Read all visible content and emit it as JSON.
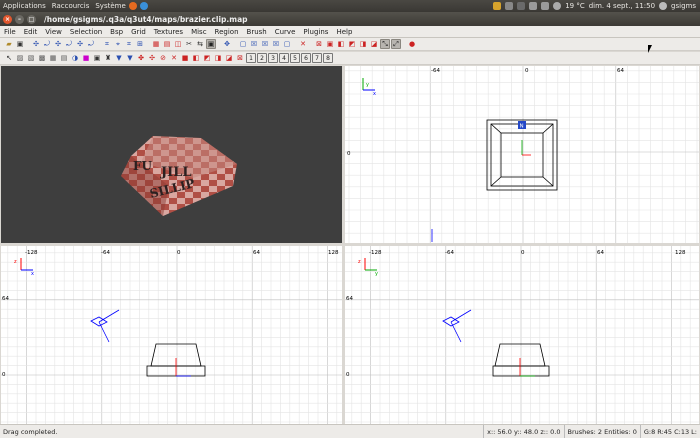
{
  "system_bar": {
    "menus": [
      "Applications",
      "Raccourcis",
      "Système"
    ],
    "weather": "19 °C",
    "clock": "dim.  4 sept., 11:50",
    "user": "gsigms"
  },
  "window": {
    "title": "/home/gsigms/.q3a/q3ut4/maps/brazier.clip.map"
  },
  "menubar": {
    "items": [
      "File",
      "Edit",
      "View",
      "Selection",
      "Bsp",
      "Grid",
      "Textures",
      "Misc",
      "Region",
      "Brush",
      "Curve",
      "Plugins",
      "Help"
    ]
  },
  "toolbar2_numbers": [
    "1",
    "2",
    "3",
    "4",
    "5",
    "6",
    "7",
    "8"
  ],
  "viewports": {
    "top": {
      "ruler_x": [
        "-64",
        "0",
        "64"
      ],
      "ruler_y": [
        "0"
      ],
      "axis_x": "x",
      "axis_y": "y",
      "entity_label": "N"
    },
    "front": {
      "ruler_x": [
        "-128",
        "-64",
        "0",
        "64",
        "128"
      ],
      "ruler_y": [
        "64",
        "0"
      ],
      "axis_x": "x",
      "axis_y": "z"
    },
    "side": {
      "ruler_x": [
        "-128",
        "-64",
        "0",
        "64",
        "128"
      ],
      "ruler_y": [
        "64",
        "0"
      ],
      "axis_x": "y",
      "axis_y": "z"
    },
    "camera": {
      "texture_text": [
        "FU",
        "JILL",
        "SILLIP"
      ]
    }
  },
  "statusbar": {
    "message": "Drag completed.",
    "coords": "x:: 56.0  y:: 48.0  z:: 0.0",
    "counts": "Brushes: 2 Entities: 0",
    "grid": "G:8 R:45 C:13 L:"
  },
  "colors": {
    "grid_minor": "#e4e4e4",
    "grid_major": "#bdbdbd",
    "brush_line": "#000000",
    "axis_x": "#ff0000",
    "axis_blue": "#0000ff",
    "camera_bg": "#3e3e3e",
    "brick": "#b5554a"
  }
}
